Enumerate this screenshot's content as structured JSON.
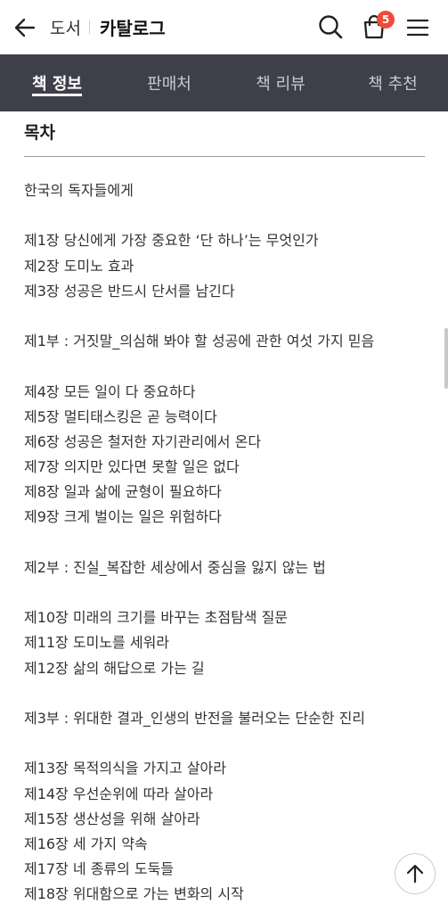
{
  "header": {
    "back_icon": "arrow-left-icon",
    "crumb_parent": "도서",
    "crumb_current": "카탈로그",
    "search_icon": "search-icon",
    "cart_icon": "shopping-bag-icon",
    "cart_count": "5",
    "menu_icon": "hamburger-menu-icon"
  },
  "tabs": [
    {
      "label": "책 정보",
      "active": true
    },
    {
      "label": "판매처",
      "active": false
    },
    {
      "label": "책 리뷰",
      "active": false
    },
    {
      "label": "책 추천",
      "active": false
    }
  ],
  "section": {
    "title": "목차"
  },
  "toc": [
    "한국의 독자들에게",
    "",
    "제1장 당신에게 가장 중요한 ‘단 하나’는 무엇인가",
    "제2장 도미노 효과",
    "제3장 성공은 반드시 단서를 남긴다",
    "",
    "제1부 : 거짓말_의심해 봐야 할 성공에 관한 여섯 가지 믿음",
    "",
    "제4장 모든 일이 다 중요하다",
    "제5장 멀티태스킹은 곧 능력이다",
    "제6장 성공은 철저한 자기관리에서 온다",
    "제7장 의지만 있다면 못할 일은 없다",
    "제8장 일과 삶에 균형이 필요하다",
    "제9장 크게 벌이는 일은 위험하다",
    "",
    "제2부 : 진실_복잡한 세상에서 중심을 잃지 않는 법",
    "",
    "제10장 미래의 크기를 바꾸는 초점탐색 질문",
    "제11장 도미노를 세워라",
    "제12장 삶의 해답으로 가는 길",
    "",
    "제3부 : 위대한 결과_인생의 반전을 불러오는 단순한 진리",
    "",
    "제13장 목적의식을 가지고 살아라",
    "제14장 우선순위에 따라 살아라",
    "제15장 생산성을 위해 살아라",
    "제16장 세 가지 약속",
    "제17장 네 종류의 도둑들",
    "제18장 위대함으로 가는 변화의 시작"
  ],
  "floating": {
    "scroll_top_icon": "arrow-up-icon"
  }
}
